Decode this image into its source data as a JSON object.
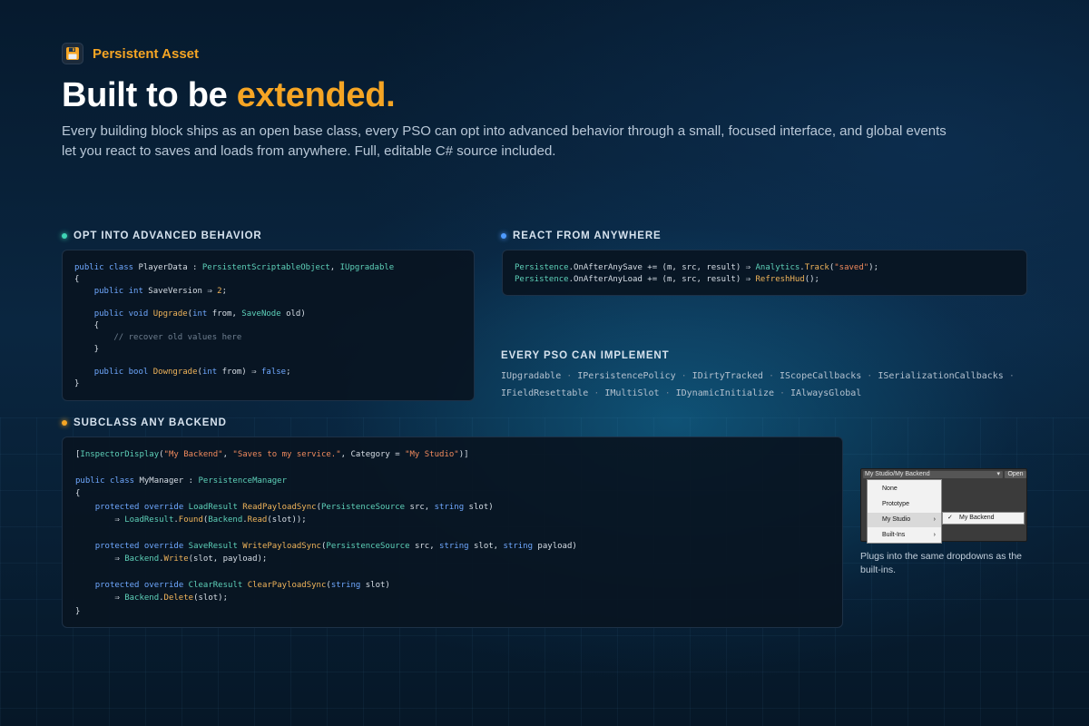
{
  "brand": {
    "name": "Persistent Asset",
    "icon": "floppy-disk-icon",
    "accent": "#f5a524"
  },
  "hero": {
    "title_prefix": "Built to be ",
    "title_accent": "extended.",
    "description": "Every building block ships as an open base class, every PSO can opt into advanced behavior through a small, focused interface, and global events let you react to saves and loads from anywhere. Full, editable C# source included."
  },
  "sections": {
    "advanced": {
      "label": "OPT INTO ADVANCED BEHAVIOR",
      "color": "#3fd4b4"
    },
    "react": {
      "label": "REACT FROM ANYWHERE",
      "color": "#4f9bff"
    },
    "backend": {
      "label": "SUBCLASS ANY BACKEND",
      "color": "#f5a524"
    },
    "implement": {
      "label": "EVERY PSO CAN IMPLEMENT"
    }
  },
  "code": {
    "advanced": [
      "public class PlayerData : PersistentScriptableObject, IUpgradable",
      "{",
      "    public int SaveVersion ⇒ 2;",
      "",
      "    public void Upgrade(int from, SaveNode old)",
      "    {",
      "        // recover old values here",
      "    }",
      "",
      "    public bool Downgrade(int from) ⇒ false;",
      "}"
    ],
    "react": [
      "Persistence.OnAfterAnySave += (m, src, result) ⇒ Analytics.Track(\"saved\");",
      "Persistence.OnAfterAnyLoad += (m, src, result) ⇒ RefreshHud();"
    ],
    "backend": [
      "[InspectorDisplay(\"My Backend\", \"Saves to my service.\", Category = \"My Studio\")]",
      "",
      "public class MyManager : PersistenceManager",
      "{",
      "    protected override LoadResult ReadPayloadSync(PersistenceSource src, string slot)",
      "        ⇒ LoadResult.Found(Backend.Read(slot));",
      "",
      "    protected override SaveResult WritePayloadSync(PersistenceSource src, string slot, string payload)",
      "        ⇒ Backend.Write(slot, payload);",
      "",
      "    protected override ClearResult ClearPayloadSync(string slot)",
      "        ⇒ Backend.Delete(slot);",
      "}"
    ]
  },
  "interfaces": {
    "separator": "·",
    "row1": [
      "IUpgradable",
      "IPersistencePolicy",
      "IDirtyTracked",
      "IScopeCallbacks",
      "ISerializationCallbacks"
    ],
    "row2": [
      "IFieldResettable",
      "IMultiSlot",
      "IDynamicInitialize",
      "IAlwaysGlobal"
    ]
  },
  "dropdown": {
    "selected": "My Studio/My Backend",
    "open_label": "Open",
    "items": [
      {
        "label": "None",
        "has_submenu": false
      },
      {
        "label": "Prototype",
        "has_submenu": false
      },
      {
        "label": "My Studio",
        "has_submenu": true
      },
      {
        "label": "Built-Ins",
        "has_submenu": true
      }
    ],
    "submenu_item": "My Backend",
    "caption": "Plugs into the same dropdowns as the built-ins."
  }
}
